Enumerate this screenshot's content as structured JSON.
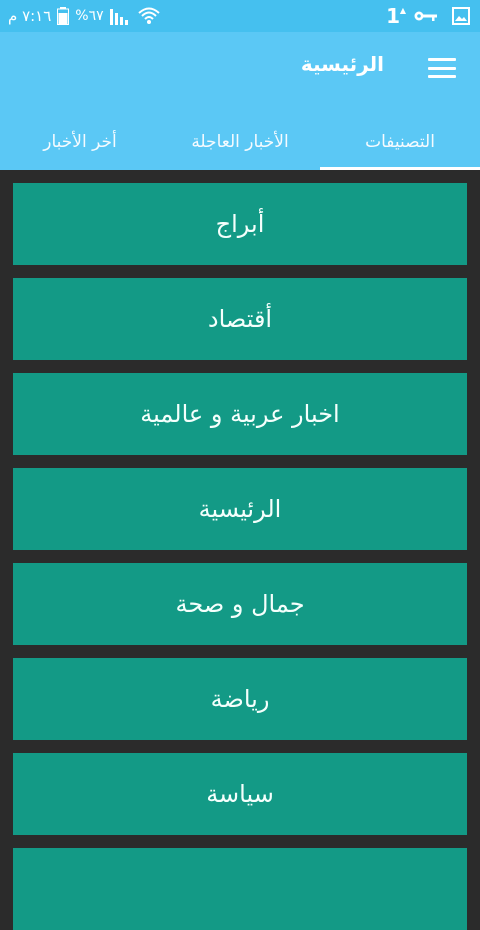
{
  "status_bar": {
    "time": "٧:١٦ م",
    "battery_percent": "%٦٧",
    "indicator": "1",
    "icons": [
      "signal-icon",
      "wifi-icon",
      "battery-icon",
      "key-icon",
      "gallery-icon"
    ]
  },
  "app_bar": {
    "title": "الرئيسية",
    "menu_icon": "hamburger-menu-icon"
  },
  "tabs": [
    {
      "label": "التصنيفات",
      "selected": true
    },
    {
      "label": "الأخبار العاجلة",
      "selected": false
    },
    {
      "label": "أخر الأخبار",
      "selected": false
    }
  ],
  "categories": [
    {
      "label": "أبراج"
    },
    {
      "label": "أقتصاد"
    },
    {
      "label": "اخبار عربية و عالمية"
    },
    {
      "label": "الرئيسية"
    },
    {
      "label": "جمال و صحة"
    },
    {
      "label": "رياضة"
    },
    {
      "label": "سياسة"
    },
    {
      "label": ""
    }
  ],
  "colors": {
    "status_bar": "#45c0ef",
    "app_bar": "#5bc8f5",
    "item_bg": "#139a86",
    "page_bg": "#2b2b2b",
    "text": "#ffffff"
  }
}
